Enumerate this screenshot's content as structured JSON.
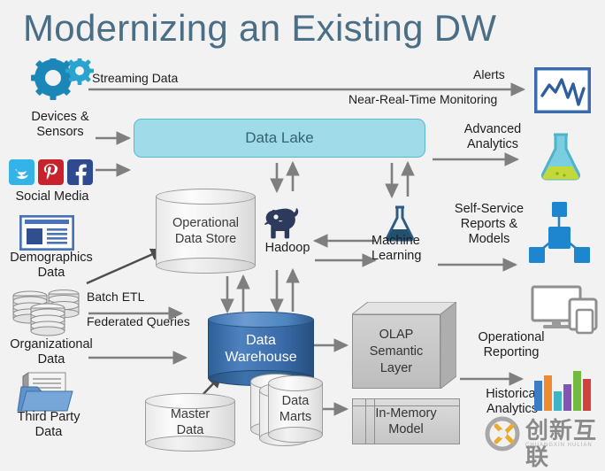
{
  "title": "Modernizing an Existing DW",
  "theme": {
    "background": "#f2f2f2",
    "title_color": "#4a6e86",
    "data_lake_fill": "#9fdbe8",
    "data_lake_border": "#59b9cc",
    "warehouse_fill": "#3a6ba8",
    "arrow_color": "#7f7f7f",
    "text_color": "#1d1d1d"
  },
  "sources": [
    {
      "id": "devices",
      "label": "Devices &\nSensors",
      "label_line1": "Devices &",
      "label_line2": "Sensors",
      "icon": "gears-icon"
    },
    {
      "id": "social",
      "label": "Social Media",
      "icon": "social-media-icon"
    },
    {
      "id": "demographics",
      "label_line1": "Demographics",
      "label_line2": "Data",
      "icon": "report-document-icon"
    },
    {
      "id": "organizational",
      "label_line1": "Organizational",
      "label_line2": "Data",
      "icon": "database-stack-icon"
    },
    {
      "id": "thirdparty",
      "label_line1": "Third Party",
      "label_line2": "Data",
      "icon": "folder-documents-icon"
    }
  ],
  "flows": {
    "streaming_data": "Streaming Data",
    "batch_etl": "Batch ETL",
    "federated_queries": "Federated Queries"
  },
  "stores": {
    "data_lake": "Data Lake",
    "ods_line1": "Operational",
    "ods_line2": "Data Store",
    "hadoop": "Hadoop",
    "machine_learning_line1": "Machine",
    "machine_learning_line2": "Learning",
    "data_warehouse_line1": "Data",
    "data_warehouse_line2": "Warehouse",
    "master_data_line1": "Master",
    "master_data_line2": "Data",
    "data_marts_line1": "Data",
    "data_marts_line2": "Marts",
    "olap_line1": "OLAP",
    "olap_line2": "Semantic",
    "olap_line3": "Layer",
    "in_memory_line1": "In-Memory",
    "in_memory_line2": "Model"
  },
  "outputs": [
    {
      "id": "alerts",
      "label_top": "Alerts",
      "label_bottom": "Near-Real-Time Monitoring",
      "icon": "line-chart-monitor-icon"
    },
    {
      "id": "advanced",
      "label_line1": "Advanced",
      "label_line2": "Analytics",
      "icon": "flask-icon"
    },
    {
      "id": "selfservice",
      "label_line1": "Self-Service",
      "label_line2": "Reports &",
      "label_line3": "Models",
      "icon": "node-network-icon"
    },
    {
      "id": "operational",
      "label_line1": "Operational",
      "label_line2": "Reporting",
      "icon": "monitor-tablet-icon"
    },
    {
      "id": "historical",
      "label_line1": "Historical",
      "label_line2": "Analytics",
      "icon": "bar-chart-icon"
    }
  ],
  "watermark": {
    "text": "创新互联",
    "sub": "CHUANGXIN HULIAN",
    "logo": "cx-logo-icon"
  }
}
